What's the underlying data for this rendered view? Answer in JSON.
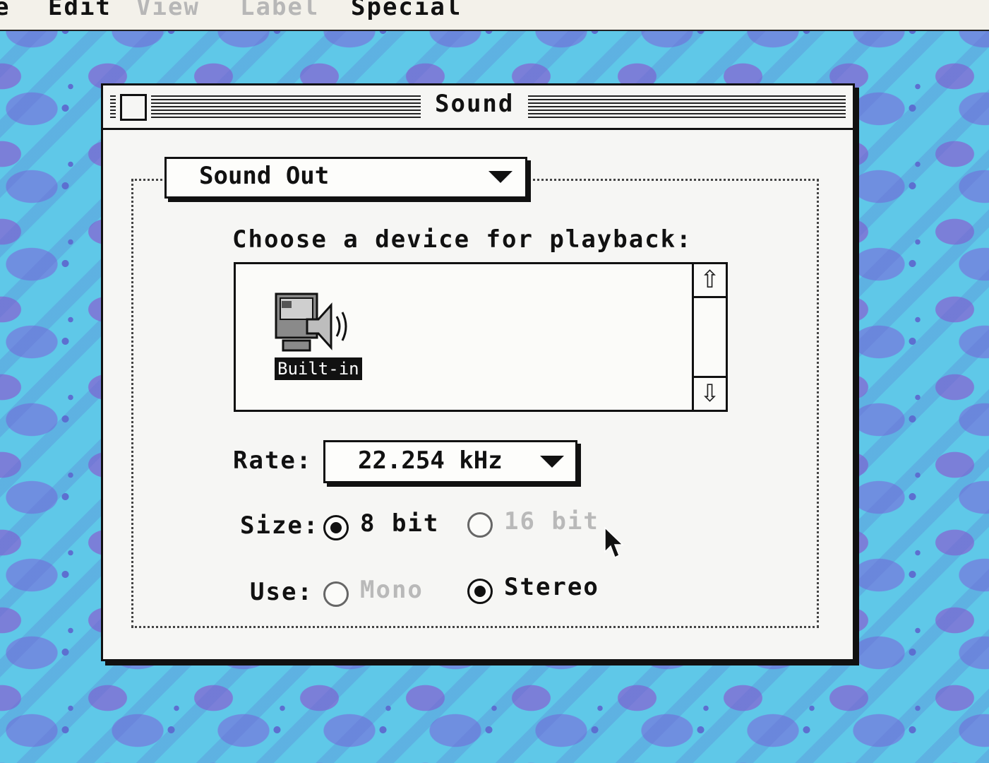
{
  "menubar": {
    "items": [
      {
        "label": "e",
        "enabled": true
      },
      {
        "label": "Edit",
        "enabled": true
      },
      {
        "label": "View",
        "enabled": false
      },
      {
        "label": "Label",
        "enabled": false
      },
      {
        "label": "Special",
        "enabled": true
      }
    ]
  },
  "window": {
    "title": "Sound",
    "panel_popup": {
      "selected": "Sound Out"
    },
    "prompt": "Choose a device for playback:",
    "devices": [
      {
        "name": "Built-in",
        "selected": true,
        "icon": "speaker-computer-icon"
      }
    ],
    "rate": {
      "label": "Rate:",
      "selected": "22.254 kHz"
    },
    "size": {
      "label": "Size:",
      "options": [
        {
          "label": "8 bit",
          "selected": true,
          "enabled": true
        },
        {
          "label": "16 bit",
          "selected": false,
          "enabled": false
        }
      ]
    },
    "use": {
      "label": "Use:",
      "options": [
        {
          "label": "Mono",
          "selected": false,
          "enabled": false
        },
        {
          "label": "Stereo",
          "selected": true,
          "enabled": true
        }
      ]
    }
  },
  "icons": {
    "close": "close-box-icon",
    "scroll_up": "arrow-up-icon",
    "scroll_down": "arrow-down-icon",
    "popup_arrow": "triangle-down-icon",
    "cursor": "pointer-cursor-icon"
  },
  "colors": {
    "desktop": "#5fc8e8",
    "desktop_pattern": "#6f7fe0",
    "window": "#f6f6f4",
    "text": "#111111",
    "disabled_text": "#b9b9b9"
  }
}
